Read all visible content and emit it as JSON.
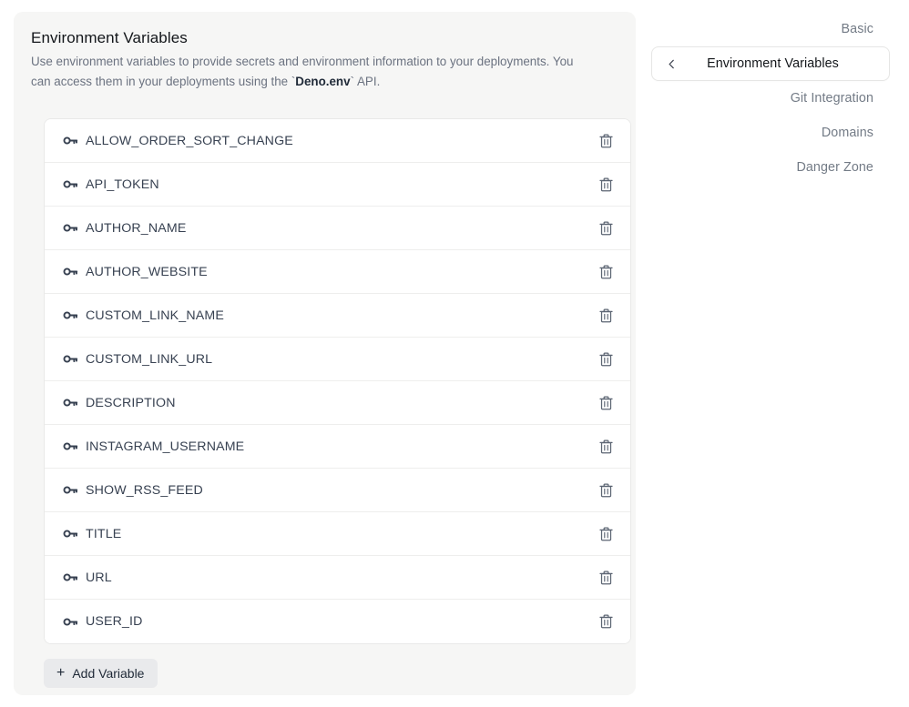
{
  "card": {
    "title": "Environment Variables",
    "description_before": "Use environment variables to provide secrets and environment information to your deployments. You can access them in your deployments using the `",
    "description_code": "Deno.env",
    "description_after": "` API.",
    "description_full": "Use environment variables to provide secrets and environment information to your deployments. You can access them in your deployments using the `Deno.env` API."
  },
  "variables": [
    {
      "name": "ALLOW_ORDER_SORT_CHANGE",
      "icon": "key-icon",
      "delete_icon": "trash-icon"
    },
    {
      "name": "API_TOKEN",
      "icon": "key-icon",
      "delete_icon": "trash-icon"
    },
    {
      "name": "AUTHOR_NAME",
      "icon": "key-icon",
      "delete_icon": "trash-icon"
    },
    {
      "name": "AUTHOR_WEBSITE",
      "icon": "key-icon",
      "delete_icon": "trash-icon"
    },
    {
      "name": "CUSTOM_LINK_NAME",
      "icon": "key-icon",
      "delete_icon": "trash-icon"
    },
    {
      "name": "CUSTOM_LINK_URL",
      "icon": "key-icon",
      "delete_icon": "trash-icon"
    },
    {
      "name": "DESCRIPTION",
      "icon": "key-icon",
      "delete_icon": "trash-icon"
    },
    {
      "name": "INSTAGRAM_USERNAME",
      "icon": "key-icon",
      "delete_icon": "trash-icon"
    },
    {
      "name": "SHOW_RSS_FEED",
      "icon": "key-icon",
      "delete_icon": "trash-icon"
    },
    {
      "name": "TITLE",
      "icon": "key-icon",
      "delete_icon": "trash-icon"
    },
    {
      "name": "URL",
      "icon": "key-icon",
      "delete_icon": "trash-icon"
    },
    {
      "name": "USER_ID",
      "icon": "key-icon",
      "delete_icon": "trash-icon"
    }
  ],
  "add_button": {
    "label": "Add Variable",
    "plus": "+"
  },
  "nav": {
    "back_icon": "chevron-left-icon",
    "items": [
      {
        "label": "Basic",
        "active": false
      },
      {
        "label": "Environment Variables",
        "active": true
      },
      {
        "label": "Git Integration",
        "active": false
      },
      {
        "label": "Domains",
        "active": false
      },
      {
        "label": "Danger Zone",
        "active": false
      }
    ]
  },
  "colors": {
    "page_background": "#ffffff",
    "card_background": "#f6f6f5",
    "list_background": "#ffffff",
    "row_border": "#eeeeed",
    "title_text": "#13161a",
    "description_text": "#6b7280",
    "variable_text": "#374151",
    "nav_inactive_text": "#737b86",
    "nav_active_text": "#13161a",
    "add_button_background": "#e9eaec",
    "icon_color": "#4b5563"
  }
}
